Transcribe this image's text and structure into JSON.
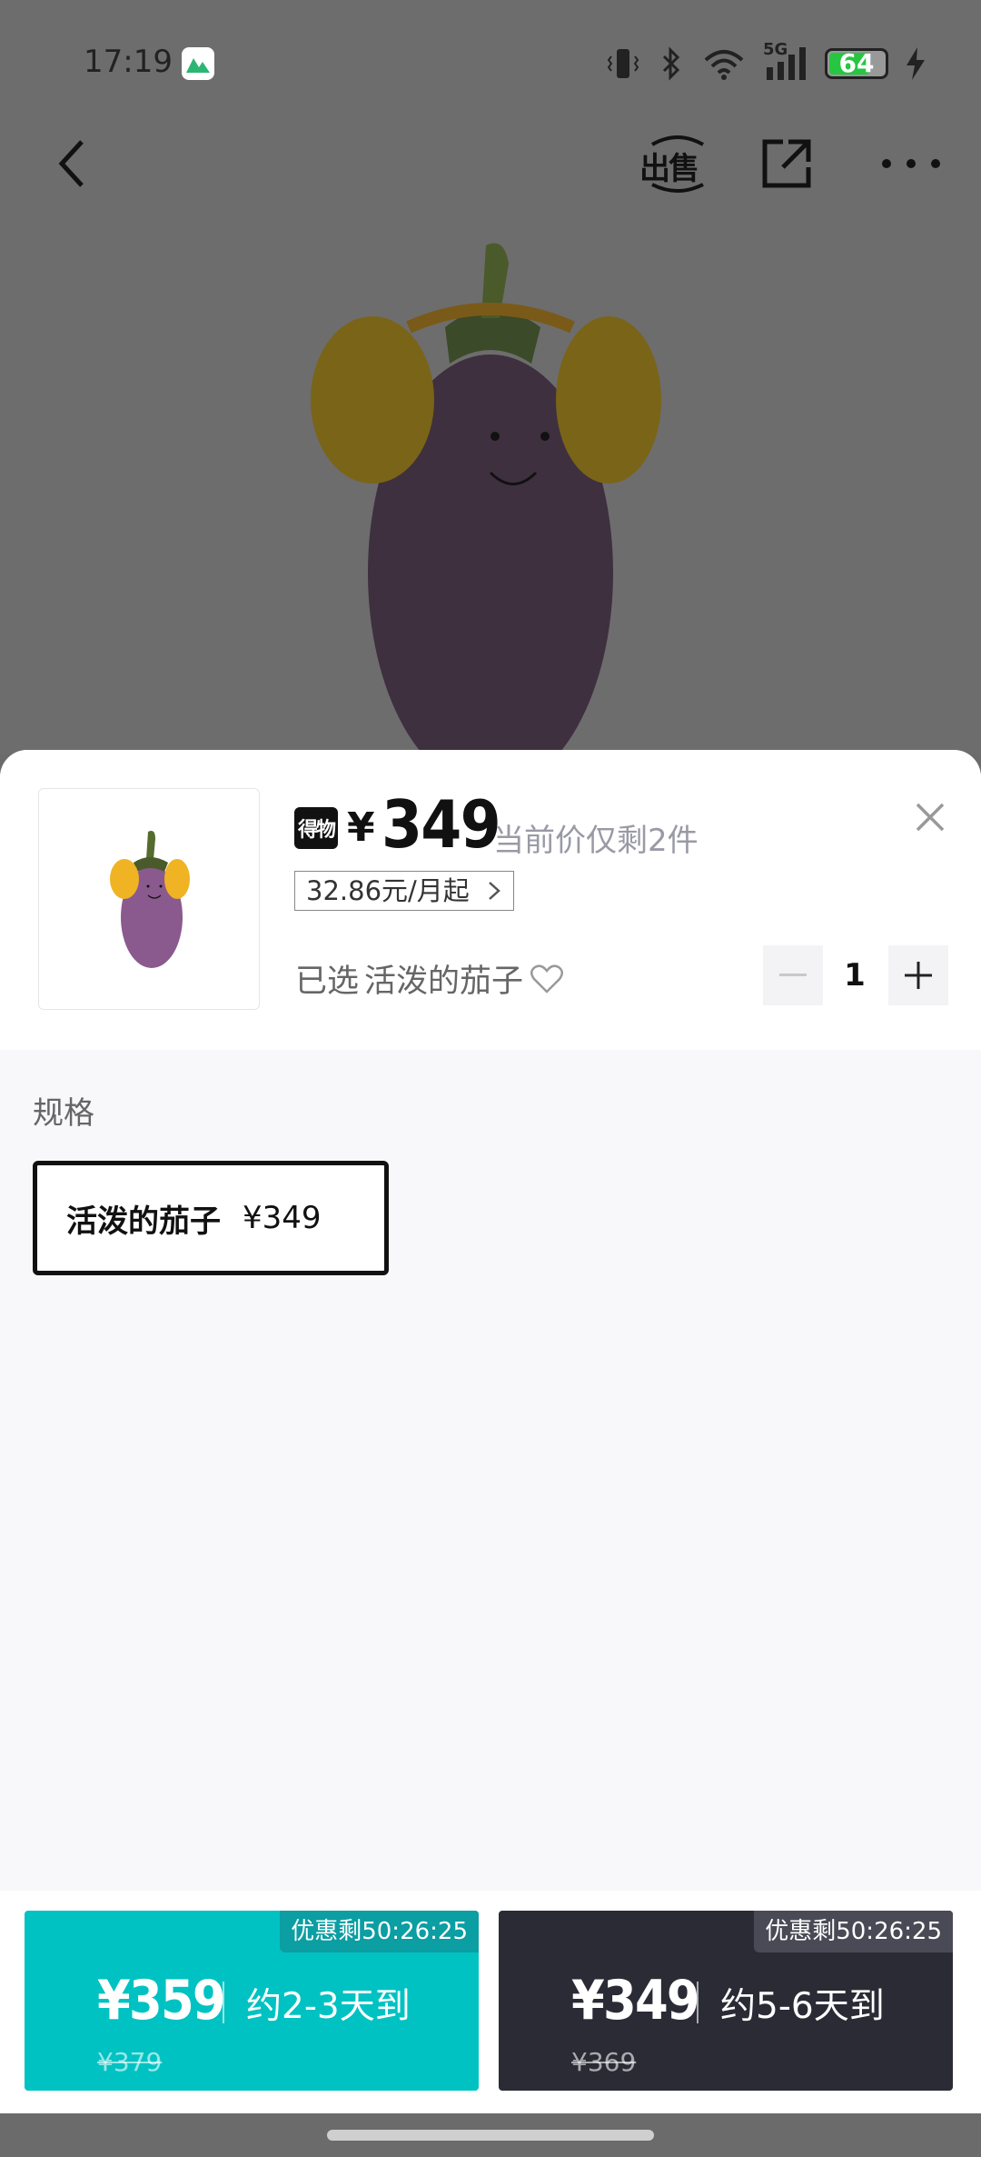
{
  "status_bar": {
    "time": "17:19",
    "network": "5G",
    "battery": "64",
    "icons": [
      "vibrate-icon",
      "bluetooth-icon",
      "wifi-icon",
      "signal-icon",
      "charging-icon"
    ]
  },
  "nav": {
    "sell_label": "出售",
    "icons": [
      "back-icon",
      "share-icon",
      "more-icon"
    ]
  },
  "sheet": {
    "logo_text": "得物",
    "currency": "¥",
    "price": "349",
    "stock_note": "当前价仅剩2件",
    "installment": "32.86元/月起",
    "selected_prefix": "已选",
    "selected_value": "活泼的茄子",
    "quantity": "1",
    "spec_title": "规格",
    "spec_options": [
      {
        "name": "活泼的茄子",
        "price": "¥349",
        "selected": true
      }
    ]
  },
  "actions": [
    {
      "promo": "优惠剩50:26:25",
      "price": "¥359",
      "eta": "约2-3天到",
      "old_price": "¥379",
      "color": "#01c2c3"
    },
    {
      "promo": "优惠剩50:26:25",
      "price": "¥349",
      "eta": "约5-6天到",
      "old_price": "¥369",
      "color": "#2b2b36"
    }
  ]
}
